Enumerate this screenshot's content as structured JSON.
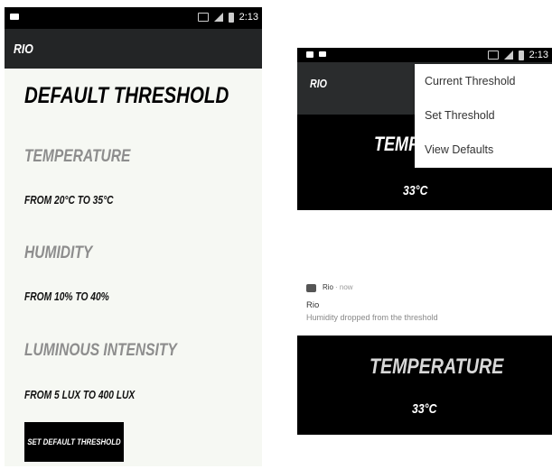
{
  "left_screen": {
    "status": {
      "time": "2:13"
    },
    "app_title": "RIO",
    "heading": "DEFAULT THRESHOLD",
    "sections": [
      {
        "title": "TEMPERATURE",
        "range": "FROM 20°C TO 35°C"
      },
      {
        "title": "HUMIDITY",
        "range": "FROM 10% TO 40%"
      },
      {
        "title": "LUMINOUS INTENSITY",
        "range": "FROM 5 LUX TO 400 LUX"
      }
    ],
    "button_label": "SET DEFAULT THRESHOLD"
  },
  "top_right_screen": {
    "status": {
      "time": "2:13"
    },
    "app_title": "RIO",
    "temperature_label": "TEMP",
    "temperature_value": "33°C",
    "menu_items": [
      "Current Threshold",
      "Set Threshold",
      "View Defaults"
    ]
  },
  "notification": {
    "app_name": "Rio",
    "time": "· now",
    "title": "Rio",
    "text": "Humidity dropped from the threshold"
  },
  "bottom_right_screen": {
    "temperature_label": "TEMPERATURE",
    "temperature_value": "33°C"
  }
}
